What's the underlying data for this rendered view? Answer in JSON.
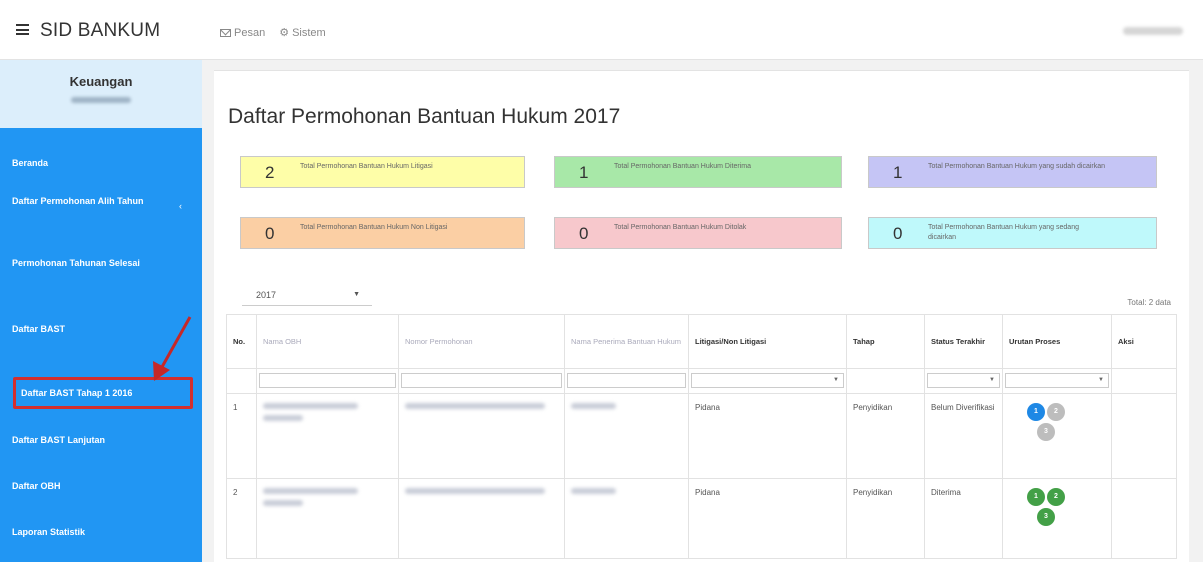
{
  "topbar": {
    "brand": "SID BANKUM",
    "nav": [
      {
        "label": "Pesan",
        "icon": "envelope-icon"
      },
      {
        "label": "Sistem",
        "icon": "gear-icon"
      }
    ]
  },
  "sidebar": {
    "profile_name": "Keuangan",
    "items": [
      {
        "label": "Beranda"
      },
      {
        "label": "Daftar Permohonan Alih Tahun",
        "has_chevron": true,
        "chevron": "‹"
      },
      {
        "label": "Permohonan Tahunan Selesai"
      },
      {
        "label": "Daftar BAST"
      },
      {
        "label": "Daftar BAST Tahap 1 2016"
      },
      {
        "label": "Daftar BAST Lanjutan"
      },
      {
        "label": "Daftar OBH"
      },
      {
        "label": "Laporan Statistik"
      }
    ]
  },
  "main": {
    "title": "Daftar Permohonan Bantuan Hukum 2017",
    "stats": [
      {
        "value": "2",
        "label": "Total Permohonan Bantuan Hukum Litigasi",
        "color": "#fefea8"
      },
      {
        "value": "1",
        "label": "Total Permohonan Bantuan Hukum Diterima",
        "color": "#a8e8a8"
      },
      {
        "value": "1",
        "label": "Total Permohonan Bantuan Hukum yang sudah dicairkan",
        "color": "#c5c5f5"
      },
      {
        "value": "0",
        "label": "Total Permohonan Bantuan Hukum Non Litigasi",
        "color": "#fbcfa4"
      },
      {
        "value": "0",
        "label": "Total Permohonan Bantuan Hukum Ditolak",
        "color": "#f7c8cc"
      },
      {
        "value": "0",
        "label": "Total Permohonan Bantuan Hukum yang sedang dicairkan",
        "color": "#bff9fb"
      }
    ],
    "year_select": "2017",
    "total_label": "Total: 2 data",
    "table": {
      "headers": [
        "No.",
        "Nama OBH",
        "Nomor Permohonan",
        "Nama Penerima Bantuan Hukum",
        "Litigasi/Non Litigasi",
        "Tahap",
        "Status Terakhir",
        "Urutan Proses",
        "Aksi"
      ],
      "rows": [
        {
          "no": "1",
          "litigasi": "Pidana",
          "tahap": "Penyidikan",
          "status": "Belum Diverifikasi",
          "steps": [
            "1",
            "2",
            "3"
          ]
        },
        {
          "no": "2",
          "litigasi": "Pidana",
          "tahap": "Penyidikan",
          "status": "Diterima",
          "steps": [
            "1",
            "2",
            "3"
          ]
        }
      ]
    }
  }
}
